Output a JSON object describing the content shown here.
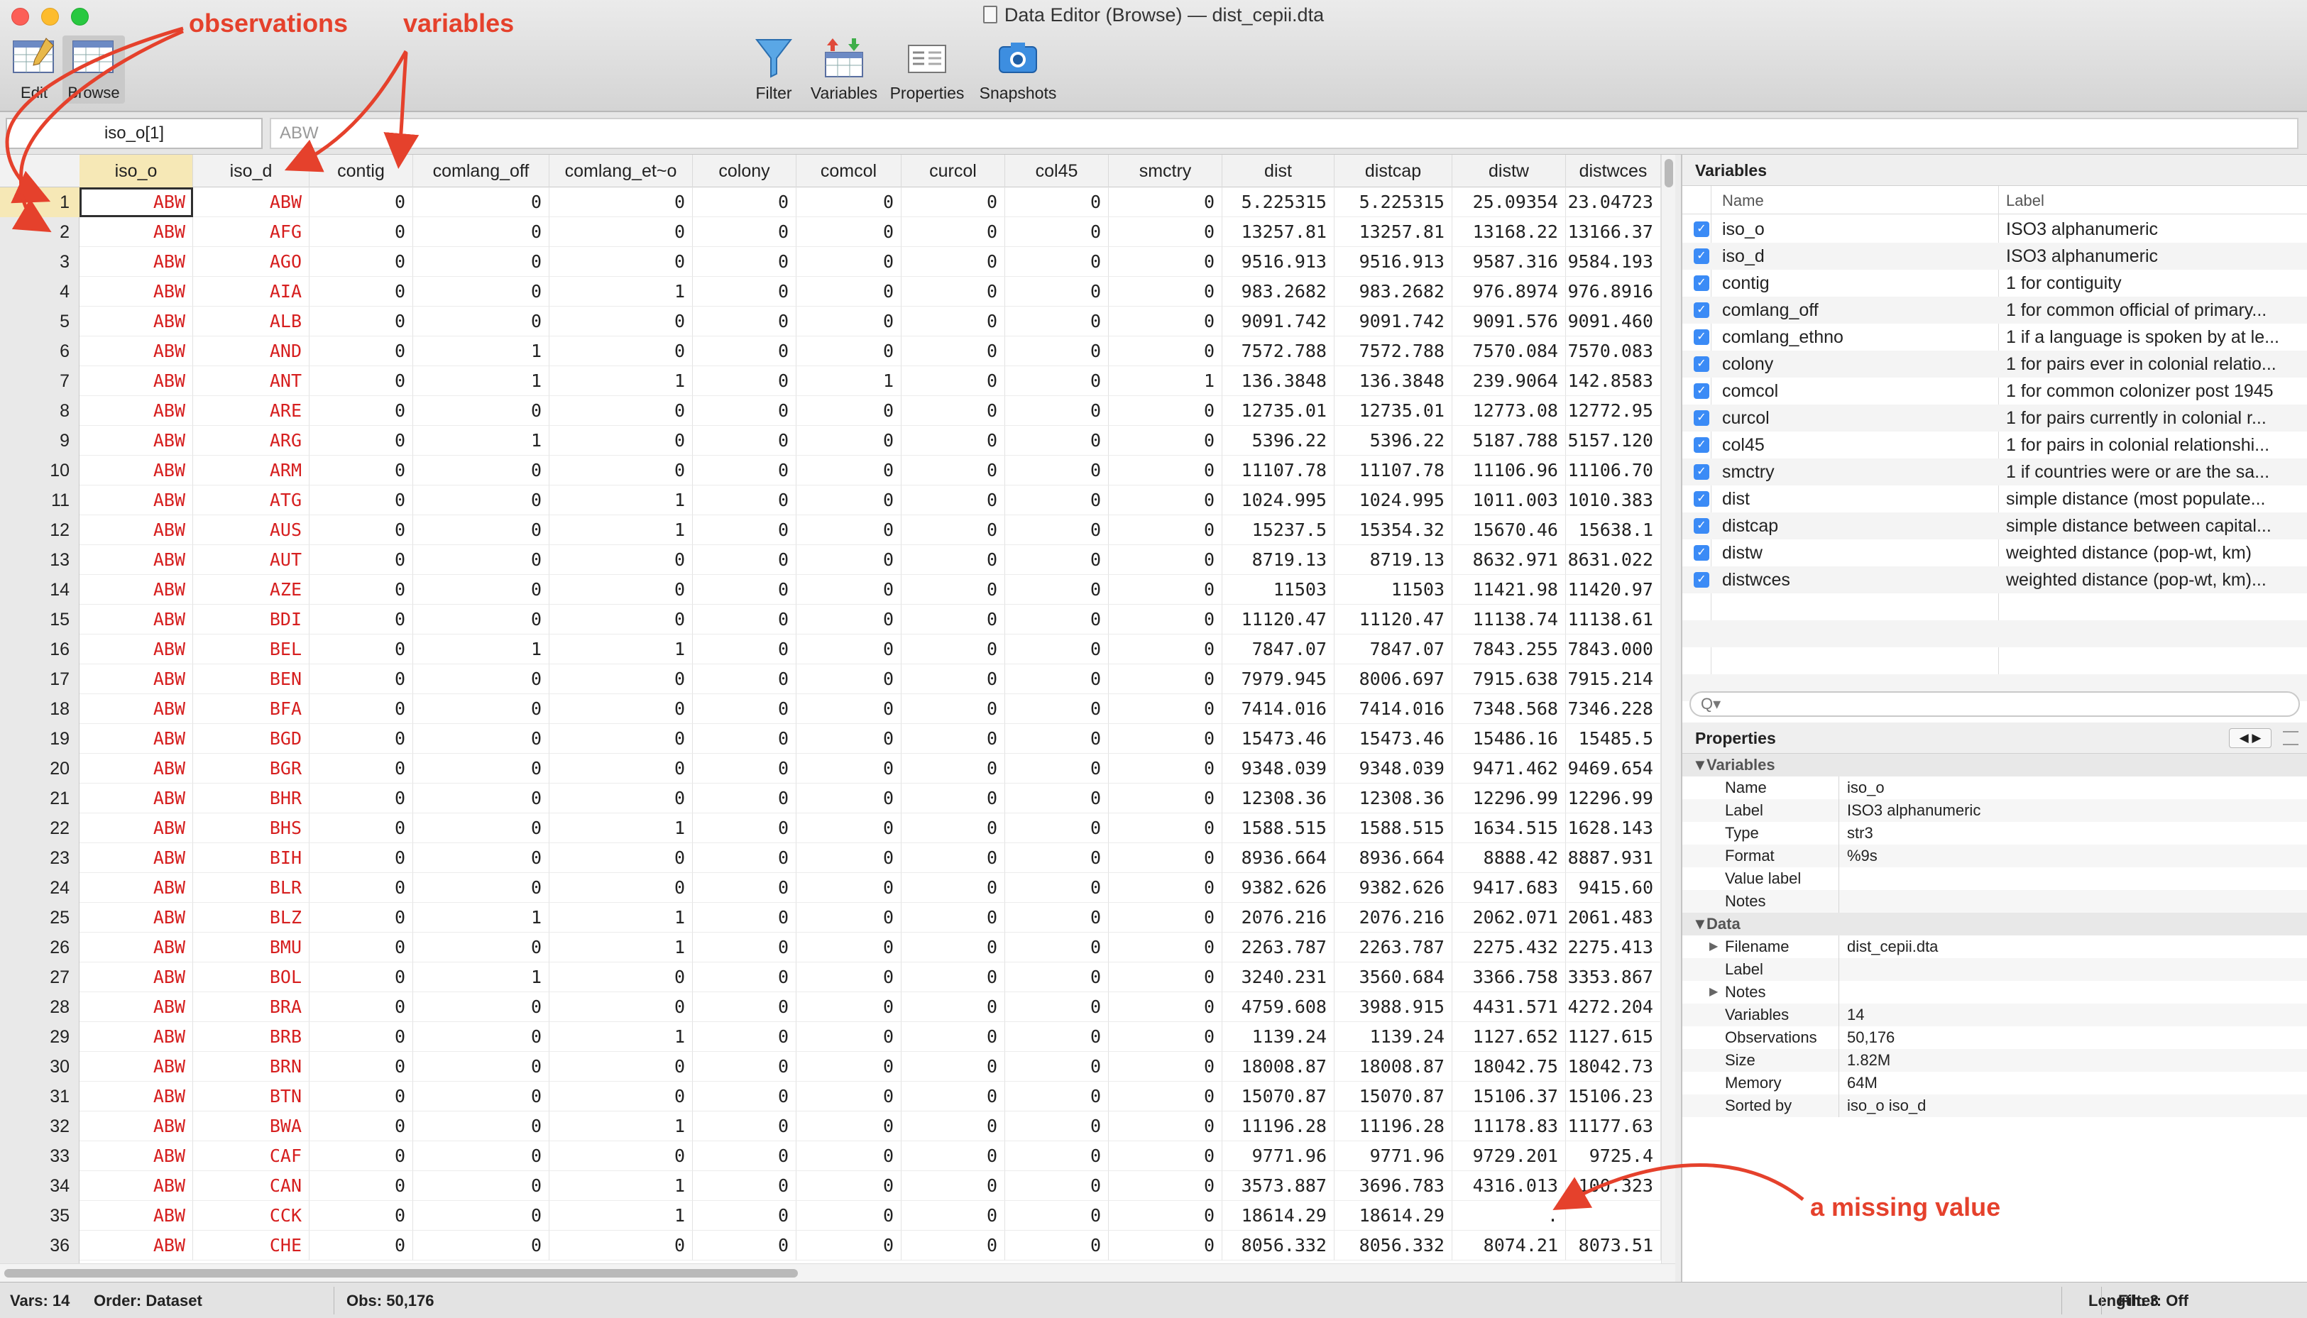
{
  "window": {
    "title": "Data Editor (Browse) — dist_cepii.dta"
  },
  "toolbar": {
    "mode_edit": "Edit",
    "mode_browse": "Browse",
    "filter": "Filter",
    "variables": "Variables",
    "properties": "Properties",
    "snapshots": "Snapshots"
  },
  "selector": {
    "cell_ref": "iso_o[1]",
    "cell_value": "ABW"
  },
  "grid": {
    "columns": [
      "iso_o",
      "iso_d",
      "contig",
      "comlang_off",
      "comlang_et~o",
      "colony",
      "comcol",
      "curcol",
      "col45",
      "smctry",
      "dist",
      "distcap",
      "distw",
      "distwces"
    ],
    "rows": [
      {
        "n": "1",
        "c": [
          "ABW",
          "ABW",
          "0",
          "0",
          "0",
          "0",
          "0",
          "0",
          "0",
          "0",
          "5.225315",
          "5.225315",
          "25.09354",
          "23.04723"
        ]
      },
      {
        "n": "2",
        "c": [
          "ABW",
          "AFG",
          "0",
          "0",
          "0",
          "0",
          "0",
          "0",
          "0",
          "0",
          "13257.81",
          "13257.81",
          "13168.22",
          "13166.37"
        ]
      },
      {
        "n": "3",
        "c": [
          "ABW",
          "AGO",
          "0",
          "0",
          "0",
          "0",
          "0",
          "0",
          "0",
          "0",
          "9516.913",
          "9516.913",
          "9587.316",
          "9584.193"
        ]
      },
      {
        "n": "4",
        "c": [
          "ABW",
          "AIA",
          "0",
          "0",
          "1",
          "0",
          "0",
          "0",
          "0",
          "0",
          "983.2682",
          "983.2682",
          "976.8974",
          "976.8916"
        ]
      },
      {
        "n": "5",
        "c": [
          "ABW",
          "ALB",
          "0",
          "0",
          "0",
          "0",
          "0",
          "0",
          "0",
          "0",
          "9091.742",
          "9091.742",
          "9091.576",
          "9091.460"
        ]
      },
      {
        "n": "6",
        "c": [
          "ABW",
          "AND",
          "0",
          "1",
          "0",
          "0",
          "0",
          "0",
          "0",
          "0",
          "7572.788",
          "7572.788",
          "7570.084",
          "7570.083"
        ]
      },
      {
        "n": "7",
        "c": [
          "ABW",
          "ANT",
          "0",
          "1",
          "1",
          "0",
          "1",
          "0",
          "0",
          "1",
          "136.3848",
          "136.3848",
          "239.9064",
          "142.8583"
        ]
      },
      {
        "n": "8",
        "c": [
          "ABW",
          "ARE",
          "0",
          "0",
          "0",
          "0",
          "0",
          "0",
          "0",
          "0",
          "12735.01",
          "12735.01",
          "12773.08",
          "12772.95"
        ]
      },
      {
        "n": "9",
        "c": [
          "ABW",
          "ARG",
          "0",
          "1",
          "0",
          "0",
          "0",
          "0",
          "0",
          "0",
          "5396.22",
          "5396.22",
          "5187.788",
          "5157.120"
        ]
      },
      {
        "n": "10",
        "c": [
          "ABW",
          "ARM",
          "0",
          "0",
          "0",
          "0",
          "0",
          "0",
          "0",
          "0",
          "11107.78",
          "11107.78",
          "11106.96",
          "11106.70"
        ]
      },
      {
        "n": "11",
        "c": [
          "ABW",
          "ATG",
          "0",
          "0",
          "1",
          "0",
          "0",
          "0",
          "0",
          "0",
          "1024.995",
          "1024.995",
          "1011.003",
          "1010.383"
        ]
      },
      {
        "n": "12",
        "c": [
          "ABW",
          "AUS",
          "0",
          "0",
          "1",
          "0",
          "0",
          "0",
          "0",
          "0",
          "15237.5",
          "15354.32",
          "15670.46",
          "15638.1"
        ]
      },
      {
        "n": "13",
        "c": [
          "ABW",
          "AUT",
          "0",
          "0",
          "0",
          "0",
          "0",
          "0",
          "0",
          "0",
          "8719.13",
          "8719.13",
          "8632.971",
          "8631.022"
        ]
      },
      {
        "n": "14",
        "c": [
          "ABW",
          "AZE",
          "0",
          "0",
          "0",
          "0",
          "0",
          "0",
          "0",
          "0",
          "11503",
          "11503",
          "11421.98",
          "11420.97"
        ]
      },
      {
        "n": "15",
        "c": [
          "ABW",
          "BDI",
          "0",
          "0",
          "0",
          "0",
          "0",
          "0",
          "0",
          "0",
          "11120.47",
          "11120.47",
          "11138.74",
          "11138.61"
        ]
      },
      {
        "n": "16",
        "c": [
          "ABW",
          "BEL",
          "0",
          "1",
          "1",
          "0",
          "0",
          "0",
          "0",
          "0",
          "7847.07",
          "7847.07",
          "7843.255",
          "7843.000"
        ]
      },
      {
        "n": "17",
        "c": [
          "ABW",
          "BEN",
          "0",
          "0",
          "0",
          "0",
          "0",
          "0",
          "0",
          "0",
          "7979.945",
          "8006.697",
          "7915.638",
          "7915.214"
        ]
      },
      {
        "n": "18",
        "c": [
          "ABW",
          "BFA",
          "0",
          "0",
          "0",
          "0",
          "0",
          "0",
          "0",
          "0",
          "7414.016",
          "7414.016",
          "7348.568",
          "7346.228"
        ]
      },
      {
        "n": "19",
        "c": [
          "ABW",
          "BGD",
          "0",
          "0",
          "0",
          "0",
          "0",
          "0",
          "0",
          "0",
          "15473.46",
          "15473.46",
          "15486.16",
          "15485.5"
        ]
      },
      {
        "n": "20",
        "c": [
          "ABW",
          "BGR",
          "0",
          "0",
          "0",
          "0",
          "0",
          "0",
          "0",
          "0",
          "9348.039",
          "9348.039",
          "9471.462",
          "9469.654"
        ]
      },
      {
        "n": "21",
        "c": [
          "ABW",
          "BHR",
          "0",
          "0",
          "0",
          "0",
          "0",
          "0",
          "0",
          "0",
          "12308.36",
          "12308.36",
          "12296.99",
          "12296.99"
        ]
      },
      {
        "n": "22",
        "c": [
          "ABW",
          "BHS",
          "0",
          "0",
          "1",
          "0",
          "0",
          "0",
          "0",
          "0",
          "1588.515",
          "1588.515",
          "1634.515",
          "1628.143"
        ]
      },
      {
        "n": "23",
        "c": [
          "ABW",
          "BIH",
          "0",
          "0",
          "0",
          "0",
          "0",
          "0",
          "0",
          "0",
          "8936.664",
          "8936.664",
          "8888.42",
          "8887.931"
        ]
      },
      {
        "n": "24",
        "c": [
          "ABW",
          "BLR",
          "0",
          "0",
          "0",
          "0",
          "0",
          "0",
          "0",
          "0",
          "9382.626",
          "9382.626",
          "9417.683",
          "9415.60"
        ]
      },
      {
        "n": "25",
        "c": [
          "ABW",
          "BLZ",
          "0",
          "1",
          "1",
          "0",
          "0",
          "0",
          "0",
          "0",
          "2076.216",
          "2076.216",
          "2062.071",
          "2061.483"
        ]
      },
      {
        "n": "26",
        "c": [
          "ABW",
          "BMU",
          "0",
          "0",
          "1",
          "0",
          "0",
          "0",
          "0",
          "0",
          "2263.787",
          "2263.787",
          "2275.432",
          "2275.413"
        ]
      },
      {
        "n": "27",
        "c": [
          "ABW",
          "BOL",
          "0",
          "1",
          "0",
          "0",
          "0",
          "0",
          "0",
          "0",
          "3240.231",
          "3560.684",
          "3366.758",
          "3353.867"
        ]
      },
      {
        "n": "28",
        "c": [
          "ABW",
          "BRA",
          "0",
          "0",
          "0",
          "0",
          "0",
          "0",
          "0",
          "0",
          "4759.608",
          "3988.915",
          "4431.571",
          "4272.204"
        ]
      },
      {
        "n": "29",
        "c": [
          "ABW",
          "BRB",
          "0",
          "0",
          "1",
          "0",
          "0",
          "0",
          "0",
          "0",
          "1139.24",
          "1139.24",
          "1127.652",
          "1127.615"
        ]
      },
      {
        "n": "30",
        "c": [
          "ABW",
          "BRN",
          "0",
          "0",
          "0",
          "0",
          "0",
          "0",
          "0",
          "0",
          "18008.87",
          "18008.87",
          "18042.75",
          "18042.73"
        ]
      },
      {
        "n": "31",
        "c": [
          "ABW",
          "BTN",
          "0",
          "0",
          "0",
          "0",
          "0",
          "0",
          "0",
          "0",
          "15070.87",
          "15070.87",
          "15106.37",
          "15106.23"
        ]
      },
      {
        "n": "32",
        "c": [
          "ABW",
          "BWA",
          "0",
          "0",
          "1",
          "0",
          "0",
          "0",
          "0",
          "0",
          "11196.28",
          "11196.28",
          "11178.83",
          "11177.63"
        ]
      },
      {
        "n": "33",
        "c": [
          "ABW",
          "CAF",
          "0",
          "0",
          "0",
          "0",
          "0",
          "0",
          "0",
          "0",
          "9771.96",
          "9771.96",
          "9729.201",
          "9725.4"
        ]
      },
      {
        "n": "34",
        "c": [
          "ABW",
          "CAN",
          "0",
          "0",
          "1",
          "0",
          "0",
          "0",
          "0",
          "0",
          "3573.887",
          "3696.783",
          "4316.013",
          "4100.323"
        ]
      },
      {
        "n": "35",
        "c": [
          "ABW",
          "CCK",
          "0",
          "0",
          "1",
          "0",
          "0",
          "0",
          "0",
          "0",
          "18614.29",
          "18614.29",
          ".",
          ""
        ]
      },
      {
        "n": "36",
        "c": [
          "ABW",
          "CHE",
          "0",
          "0",
          "0",
          "0",
          "0",
          "0",
          "0",
          "0",
          "8056.332",
          "8056.332",
          "8074.21",
          "8073.51"
        ]
      }
    ]
  },
  "variables_panel": {
    "title": "Variables",
    "col_name": "Name",
    "col_label": "Label",
    "items": [
      {
        "name": "iso_o",
        "label": "ISO3 alphanumeric"
      },
      {
        "name": "iso_d",
        "label": "ISO3 alphanumeric"
      },
      {
        "name": "contig",
        "label": "1 for contiguity"
      },
      {
        "name": "comlang_off",
        "label": "1 for common official of primary..."
      },
      {
        "name": "comlang_ethno",
        "label": "1 if a language is spoken by at le..."
      },
      {
        "name": "colony",
        "label": "1 for pairs ever in colonial relatio..."
      },
      {
        "name": "comcol",
        "label": "1 for common colonizer post 1945"
      },
      {
        "name": "curcol",
        "label": "1 for pairs currently in colonial r..."
      },
      {
        "name": "col45",
        "label": "1 for pairs in colonial relationshi..."
      },
      {
        "name": "smctry",
        "label": "1 if countries were or are the sa..."
      },
      {
        "name": "dist",
        "label": "simple distance (most populate..."
      },
      {
        "name": "distcap",
        "label": "simple distance between capital..."
      },
      {
        "name": "distw",
        "label": "weighted distance (pop-wt, km)"
      },
      {
        "name": "distwces",
        "label": "weighted distance (pop-wt, km)..."
      }
    ],
    "search_placeholder": "Q▾"
  },
  "properties_panel": {
    "title": "Properties",
    "nav": "◀ ▶",
    "variables_group": "Variables",
    "data_group": "Data",
    "variable_props": [
      {
        "k": "Name",
        "v": "iso_o"
      },
      {
        "k": "Label",
        "v": "ISO3 alphanumeric"
      },
      {
        "k": "Type",
        "v": "str3"
      },
      {
        "k": "Format",
        "v": "%9s"
      },
      {
        "k": "Value label",
        "v": ""
      },
      {
        "k": "Notes",
        "v": ""
      }
    ],
    "data_props": [
      {
        "k": "Filename",
        "v": "dist_cepii.dta"
      },
      {
        "k": "Label",
        "v": ""
      },
      {
        "k": "Notes",
        "v": ""
      },
      {
        "k": "Variables",
        "v": "14"
      },
      {
        "k": "Observations",
        "v": "50,176"
      },
      {
        "k": "Size",
        "v": "1.82M"
      },
      {
        "k": "Memory",
        "v": "64M"
      },
      {
        "k": "Sorted by",
        "v": "iso_o iso_d"
      }
    ]
  },
  "status": {
    "vars": "Vars: 14",
    "order": "Order: Dataset",
    "obs": "Obs: 50,176",
    "length": "Length: 3",
    "filter": "Filter: Off"
  },
  "annotations": {
    "observations": "observations",
    "variables": "variables",
    "missing": "a missing value"
  },
  "colors": {
    "annotation": "#e5412c",
    "string_value": "#d61f1f",
    "current": "#f6e8b6",
    "checkbox": "#3b8bf6"
  }
}
